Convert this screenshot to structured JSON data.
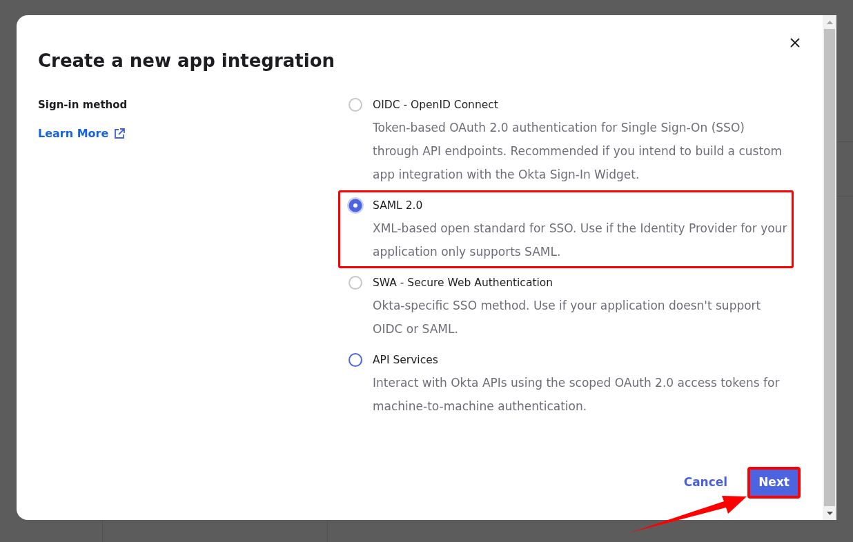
{
  "dialog": {
    "title": "Create a new app integration"
  },
  "sign_in": {
    "label": "Sign-in method",
    "link": "Learn More"
  },
  "options": [
    {
      "label": "OIDC - OpenID Connect",
      "description": "Token-based OAuth 2.0 authentication for Single Sign-On (SSO) through API endpoints. Recommended if you intend to build a custom app integration with the Okta Sign-In Widget.",
      "selected": false,
      "hovered": false,
      "highlighted": false
    },
    {
      "label": "SAML 2.0",
      "description": "XML-based open standard for SSO. Use if the Identity Provider for your application only supports SAML.",
      "selected": true,
      "hovered": false,
      "highlighted": true
    },
    {
      "label": "SWA - Secure Web Authentication",
      "description": "Okta-specific SSO method. Use if your application doesn't support OIDC or SAML.",
      "selected": false,
      "hovered": false,
      "highlighted": false
    },
    {
      "label": "API Services",
      "description": "Interact with Okta APIs using the scoped OAuth 2.0 access tokens for machine-to-machine authentication.",
      "selected": false,
      "hovered": true,
      "highlighted": false
    }
  ],
  "footer": {
    "cancel": "Cancel",
    "next": {
      "label": "Next",
      "highlighted": true,
      "arrow": true
    }
  }
}
